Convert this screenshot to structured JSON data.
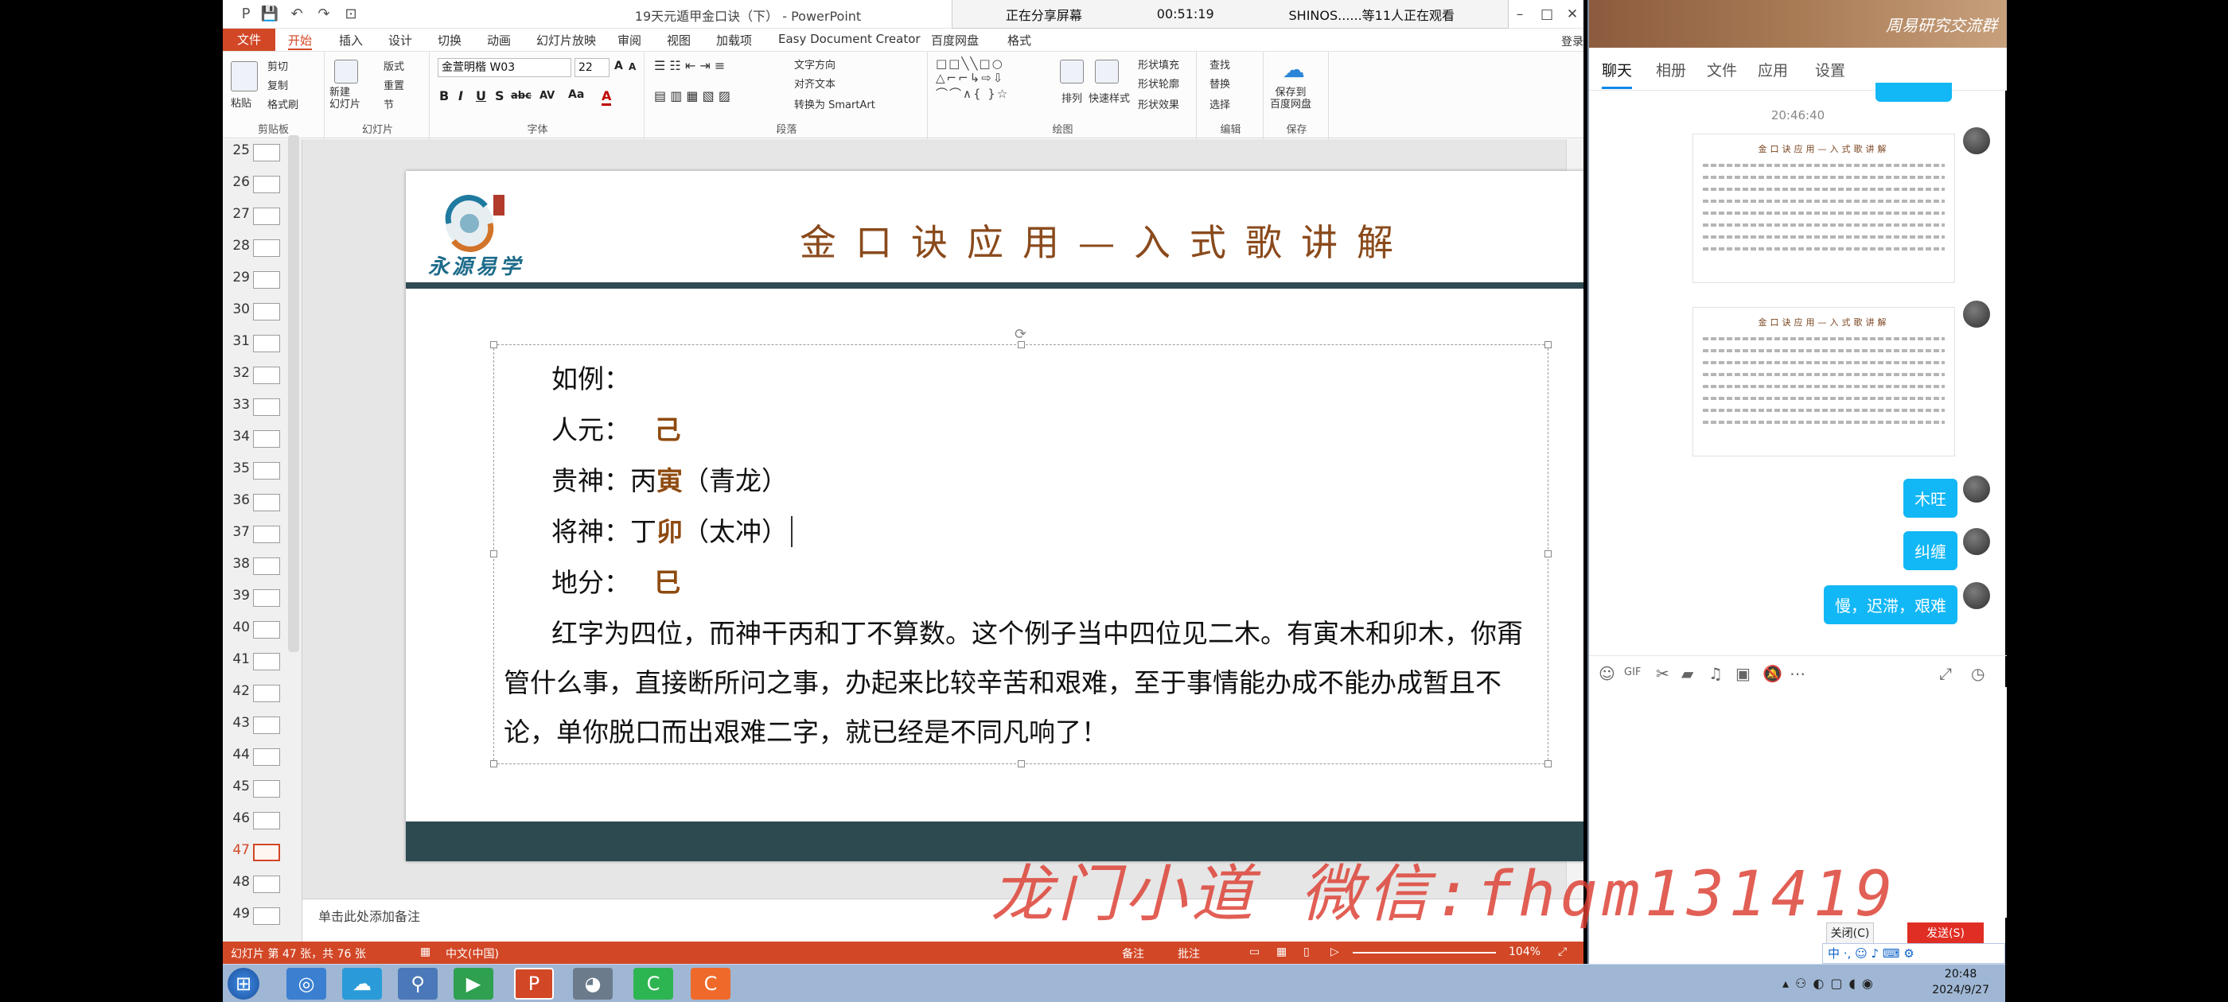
{
  "window": {
    "title": "19天元遁甲金口诀（下） - PowerPoint",
    "login": "登录",
    "controls": [
      "?",
      "▣",
      "–",
      "□",
      "✕"
    ]
  },
  "share_banner": {
    "status": "正在分享屏幕",
    "elapsed": "00:51:19",
    "viewers": "SHINOS......等11人正在观看"
  },
  "ribbon": {
    "tabs": [
      "文件",
      "开始",
      "插入",
      "设计",
      "切换",
      "动画",
      "幻灯片放映",
      "审阅",
      "视图",
      "加载项",
      "Easy Document Creator",
      "百度网盘",
      "格式"
    ],
    "active_tab": "开始",
    "clipboard": {
      "paste": "粘贴",
      "cut": "剪切",
      "copy": "复制",
      "format_painter": "格式刷",
      "label": "剪贴板"
    },
    "slides": {
      "new_slide": "新建\n幻灯片",
      "layout": "版式",
      "reset": "重置",
      "section": "节",
      "label": "幻灯片"
    },
    "font": {
      "name": "金萱明楷 W03",
      "size": "22",
      "label": "字体",
      "bold": "B",
      "italic": "I",
      "underline": "U",
      "shadow": "S",
      "strike": "abc",
      "spacing": "AV",
      "case": "Aa",
      "color": "A"
    },
    "paragraph": {
      "text_direction": "文字方向",
      "align_text": "对齐文本",
      "smartart": "转换为 SmartArt",
      "label": "段落"
    },
    "drawing": {
      "arrange": "排列",
      "quick_styles": "快速样式",
      "shape_fill": "形状填充",
      "shape_outline": "形状轮廓",
      "shape_effects": "形状效果",
      "label": "绘图"
    },
    "editing": {
      "find": "查找",
      "replace": "替换",
      "select": "选择",
      "label": "编辑"
    },
    "save": {
      "save_to_baidu": "保存到\n百度网盘",
      "label": "保存"
    }
  },
  "thumbnails": {
    "numbers": [
      "25",
      "26",
      "27",
      "28",
      "29",
      "30",
      "31",
      "32",
      "33",
      "34",
      "35",
      "36",
      "37",
      "38",
      "39",
      "40",
      "41",
      "42",
      "43",
      "44",
      "45",
      "46",
      "47",
      "48",
      "49"
    ],
    "selected": "47"
  },
  "slide": {
    "logo_text": "永源易学",
    "title": "金口诀应用—入式歌讲解",
    "example_label": "如例：",
    "renyuan_label": "人元：",
    "renyuan_value": "己",
    "guishen_label": "贵神：丙",
    "guishen_value": "寅",
    "guishen_suffix": "（青龙）",
    "jiangshen_label": "将神：丁",
    "jiangshen_value": "卯",
    "jiangshen_suffix": "（太冲）",
    "difen_label": "地分：",
    "difen_value": "巳",
    "paragraph": "红字为四位，而神干丙和丁不算数。这个例子当中四位见二木。有寅木和卯木，你甭管什么事，直接断所问之事，办起来比较辛苦和艰难，至于事情能办成不能办成暂且不论，单你脱口而出艰难二字，就已经是不同凡响了！"
  },
  "notes_placeholder": "单击此处添加备注",
  "status": {
    "slide_info": "幻灯片 第 47 张，共 76 张",
    "language": "中文(中国)",
    "notes": "备注",
    "comments": "批注",
    "zoom": "104%"
  },
  "watermark": "龙门小道 微信:fhqm131419",
  "chat": {
    "header_title": "周易研究交流群",
    "tabs": [
      "聊天",
      "相册",
      "文件",
      "应用",
      "设置"
    ],
    "active_tab": "聊天",
    "timestamp": "20:46:40",
    "image_title_1": "金口诀应用—入式歌讲解",
    "image_title_2": "金口诀应用—入式歌讲解",
    "messages": [
      "木旺",
      "纠缠",
      "慢，迟滞，艰难"
    ],
    "close_label": "关闭(C)",
    "send_label": "发送(S)",
    "ime": "中 ·, ☺ ♪ ⌨ ⚙"
  },
  "taskbar": {
    "time": "20:48",
    "date": "2024/9/27"
  },
  "colors": {
    "accent": "#d24726",
    "slide_bar": "#2e4a52",
    "highlight_text": "#8e4a10",
    "qq_bubble": "#12b7f5",
    "watermark": "#dc3c30"
  }
}
